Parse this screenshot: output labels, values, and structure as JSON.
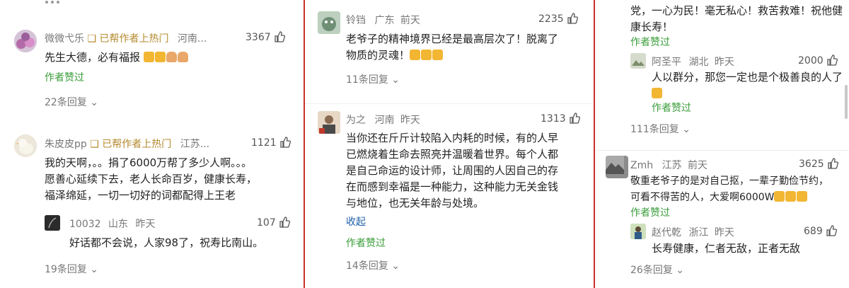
{
  "panel1": {
    "c1": {
      "user": "微微弋乐",
      "badge": "已帮作者上热门",
      "loc": "河南...",
      "likes": "3367",
      "text": "先生大德，必有福报",
      "praised": "作者赞过",
      "replies": "22条回复"
    },
    "c2": {
      "user": "朱皮皮pp",
      "badge": "已帮作者上热门",
      "loc": "江苏...",
      "likes": "1121",
      "text1": "我的天啊，。。捐了6000万帮了多少人啊。。。",
      "text2": "愿善心延续下去，老人长命百岁，健康长寿，",
      "text3": "福泽绵延，一切一切好的词都配得上王老",
      "reply": {
        "user": "10032",
        "loc": "山东",
        "time": "昨天",
        "likes": "107",
        "text": "好话都不会说，人家98了，祝寿比南山。"
      },
      "replies": "19条回复"
    }
  },
  "panel2": {
    "c1": {
      "user": "铃铛",
      "loc": "广东",
      "time": "前天",
      "likes": "2235",
      "text1": "老爷子的精神境界已经是最高层次了！脱离了",
      "text2": "物质的灵魂！",
      "replies": "11条回复"
    },
    "c2": {
      "user": "为之",
      "loc": "河南",
      "time": "昨天",
      "likes": "1313",
      "text1": "当你还在斤斤计较陷入内耗的时候，有的人早",
      "text2": "已燃烧着生命去照亮并温暖着世界。每个人都",
      "text3": "是自己命运的设计师，让周围的人因自己的存",
      "text4": "在而感到幸福是一种能力，这种能力无关金钱",
      "text5": "与地位，也无关年龄与处境。",
      "collapse": "收起",
      "praised": "作者赞过",
      "replies": "14条回复"
    }
  },
  "panel3": {
    "top": {
      "text1": "党，一心为民！毫无私心！救苦救难！祝他健",
      "text2": "康长寿！",
      "praised": "作者赞过",
      "reply": {
        "user": "阿圣平",
        "loc": "湖北",
        "time": "昨天",
        "likes": "2000",
        "text1": "人以群分，那您一定也是个极善良的人了",
        "praised": "作者赞过"
      },
      "replies": "111条回复"
    },
    "c2": {
      "user": "Zmh",
      "loc": "江苏",
      "time": "前天",
      "likes": "3625",
      "text1": "敬重老爷子的是对自己抠，一辈子勤俭节约，",
      "text2": "可看不得苦的人，大爱啊6000W",
      "praised": "作者赞过",
      "reply": {
        "user": "赵代乾",
        "loc": "浙江",
        "time": "昨天",
        "likes": "689",
        "text": "长寿健康，仁者无敌，正者无敌"
      },
      "replies": "26条回复"
    }
  },
  "colors": {
    "accent_border": "#c9302c",
    "praised": "#3a9c3a",
    "badge": "#b58a2e",
    "link": "#1f5fa8"
  }
}
